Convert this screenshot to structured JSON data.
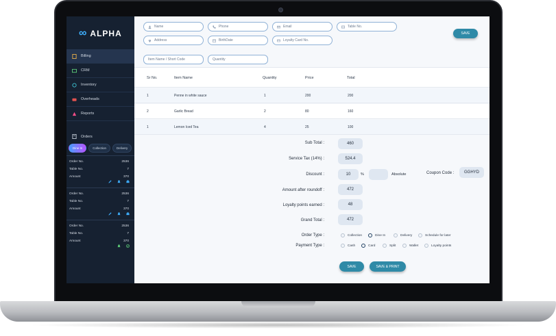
{
  "app": {
    "logo_text": "ALPHA"
  },
  "sidebar": {
    "items": [
      {
        "label": "Billing",
        "icon": "billing-icon"
      },
      {
        "label": "CRM",
        "icon": "crm-icon"
      },
      {
        "label": "Inventory",
        "icon": "inventory-icon"
      },
      {
        "label": "Overheads",
        "icon": "overheads-icon"
      },
      {
        "label": "Reports",
        "icon": "reports-icon"
      }
    ],
    "orders_label": "Orders",
    "order_tabs": [
      "Dine In",
      "Collection",
      "Delivery"
    ],
    "orders": [
      {
        "order_no_label": "Order No.",
        "order_no": "2536",
        "table_label": "Table No.",
        "table": "7",
        "amount_label": "Amount",
        "amount": "370"
      },
      {
        "order_no_label": "Order No.",
        "order_no": "2536",
        "table_label": "Table No.",
        "table": "7",
        "amount_label": "Amount",
        "amount": "370"
      },
      {
        "order_no_label": "Order No.",
        "order_no": "2536",
        "table_label": "Table No.",
        "table": "7",
        "amount_label": "Amount",
        "amount": "370"
      }
    ]
  },
  "form": {
    "name": "Name",
    "phone": "Phone",
    "email": "Email",
    "table_no": "Table No.",
    "address": "Address",
    "birthdate": "BirthDate",
    "loyalty": "Loyalty Card No.",
    "save": "SAVE",
    "item_name": "Item Name / Short Code",
    "quantity": "Quantity"
  },
  "table": {
    "headers": [
      "Sr No.",
      "Item Name",
      "Quantity",
      "Price",
      "Total"
    ],
    "rows": [
      [
        "1",
        "Penne in white sauce",
        "1",
        "200",
        "200"
      ],
      [
        "2",
        "Garlic Bread",
        "2",
        "80",
        "160"
      ],
      [
        "1",
        "Lemon Iced Tea",
        "4",
        "25",
        "100"
      ]
    ]
  },
  "summary": {
    "subtotal_label": "Sub Total :",
    "subtotal": "460",
    "tax_label": "Service Tax (14%) :",
    "tax": "524.4",
    "discount_label": "Discount :",
    "discount": "10",
    "percent": "%",
    "absolute": "Absolute",
    "coupon_label": "Coupon Code :",
    "coupon": "GGHYD",
    "roundoff_label": "Amount after roundoff :",
    "roundoff": "472",
    "loyalty_label": "Loyalty points earned :",
    "loyalty": "48",
    "grand_label": "Grand Total :",
    "grand": "472"
  },
  "order_type": {
    "label": "Order Type :",
    "options": [
      "Collection",
      "Dine In",
      "Delivery",
      "Schedule for later"
    ],
    "selected": "Dine In"
  },
  "payment_type": {
    "label": "Payment Type :",
    "options": [
      "Cash",
      "Card",
      "Split",
      "Wallet",
      "Loyalty points"
    ],
    "selected": "Card"
  },
  "actions": {
    "save": "SAVE",
    "save_print": "SAVE & PRINT"
  },
  "colors": {
    "sidebar_bg": "#162131",
    "accent": "#2f8aa7",
    "logo_accent": "#3fb0ff"
  }
}
